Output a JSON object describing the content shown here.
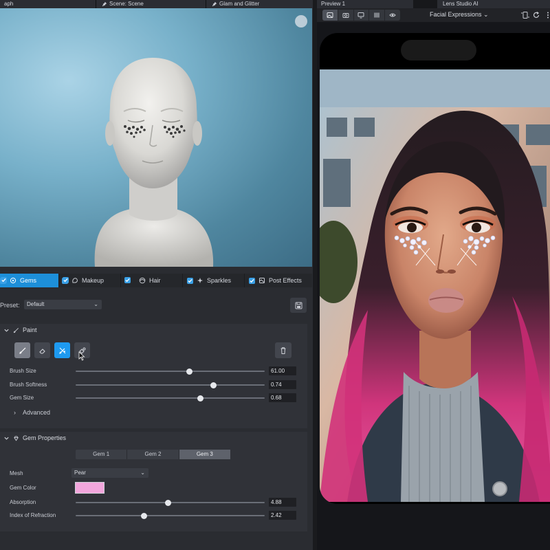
{
  "left_tabs": [
    {
      "label": "aph",
      "icon": "none"
    },
    {
      "label": "Scene: Scene",
      "icon": "pin-icon"
    },
    {
      "label": "Glam and Glitter",
      "icon": "pin-icon"
    }
  ],
  "subtabs": [
    {
      "label": "Gems",
      "checked": true,
      "active": true
    },
    {
      "label": "Makeup",
      "checked": true,
      "active": false
    },
    {
      "label": "Hair",
      "checked": true,
      "active": false
    },
    {
      "label": "Sparkles",
      "checked": true,
      "active": false
    },
    {
      "label": "Post Effects",
      "checked": true,
      "active": false
    }
  ],
  "preset": {
    "label": "Preset:",
    "value": "Default"
  },
  "paint": {
    "title": "Paint",
    "tools": [
      "brush-tool",
      "eraser-tool",
      "gem-brush-tool",
      "gem-eraser-tool"
    ],
    "brush_size": {
      "label": "Brush Size",
      "value": "61.00",
      "fraction": 0.6
    },
    "brush_softness": {
      "label": "Brush Softness",
      "value": "0.74",
      "fraction": 0.73
    },
    "gem_size": {
      "label": "Gem Size",
      "value": "0.68",
      "fraction": 0.66
    },
    "advanced_label": "Advanced"
  },
  "gem_properties": {
    "title": "Gem Properties",
    "gems": [
      "Gem 1",
      "Gem 2",
      "Gem 3"
    ],
    "selected_gem": 2,
    "mesh": {
      "label": "Mesh",
      "value": "Pear"
    },
    "gem_color": {
      "label": "Gem Color",
      "color": "#f2a6dc"
    },
    "absorption": {
      "label": "Absorption",
      "value": "4.88",
      "fraction": 0.49
    },
    "index_of_refraction": {
      "label": "Index of Refraction",
      "value": "2.42",
      "fraction": 0.36
    }
  },
  "preview": {
    "tab1": "Preview 1",
    "tab2": "Lens Studio AI",
    "dropdown": "Facial Expressions"
  },
  "colors": {
    "accent": "#1d8fd9",
    "panel": "#2a2c31",
    "gem_color": "#f2a6dc"
  }
}
